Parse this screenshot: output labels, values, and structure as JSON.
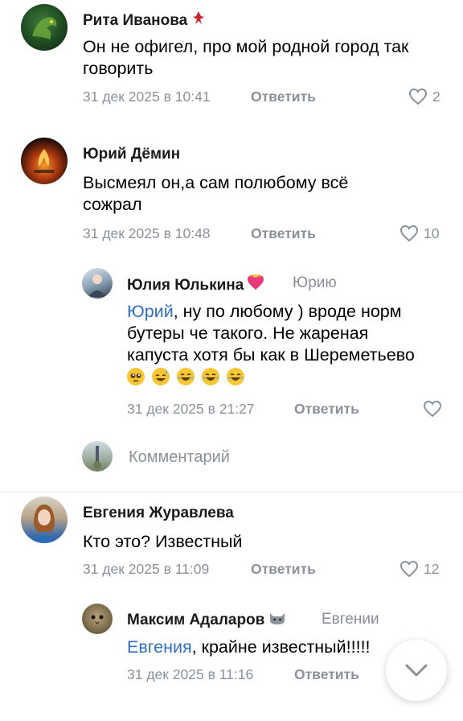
{
  "comments": [
    {
      "author": "Рита Иванова",
      "text": "Он не офигел, про мой родной город так говорить",
      "date": "31 дек 2025 в 10:41",
      "reply_label": "Ответить",
      "likes": "2",
      "badge_icon": "fire-person-icon"
    },
    {
      "author": "Юрий Дёмин",
      "text": "Высмеял он,а сам полюбому всё сожрал",
      "date": "31 дек 2025 в 10:48",
      "reply_label": "Ответить",
      "likes": "10"
    },
    {
      "author": "Юлия Юлькина",
      "reply_to": "Юрию",
      "mention": "Юрий",
      "text": ", ну по любому ) вроде норм бутеры че такого. Не жареная капуста хотя бы как в Шереметьево",
      "emojis": [
        "pleading-face-icon",
        "sweat-smile-icon",
        "joy-icon",
        "joy-icon",
        "joy-icon"
      ],
      "date": "31 дек 2025 в 21:27",
      "reply_label": "Ответить",
      "likes": ""
    },
    {
      "author": "Евгения Журавлева",
      "text": "Кто это? Известный",
      "date": "31 дек 2025 в 11:09",
      "reply_label": "Ответить",
      "likes": "12"
    },
    {
      "author": "Максим Адаларов",
      "reply_to": "Евгении",
      "mention": "Евгения",
      "text": ", крайне известный!!!!!",
      "date": "31 дек 2025 в 11:16",
      "reply_label": "Ответить"
    }
  ],
  "composer": {
    "placeholder": "Комментарий"
  },
  "colors": {
    "mention": "#2d6fc4",
    "meta": "#8a9199",
    "badge_heart": "#e8397b"
  }
}
